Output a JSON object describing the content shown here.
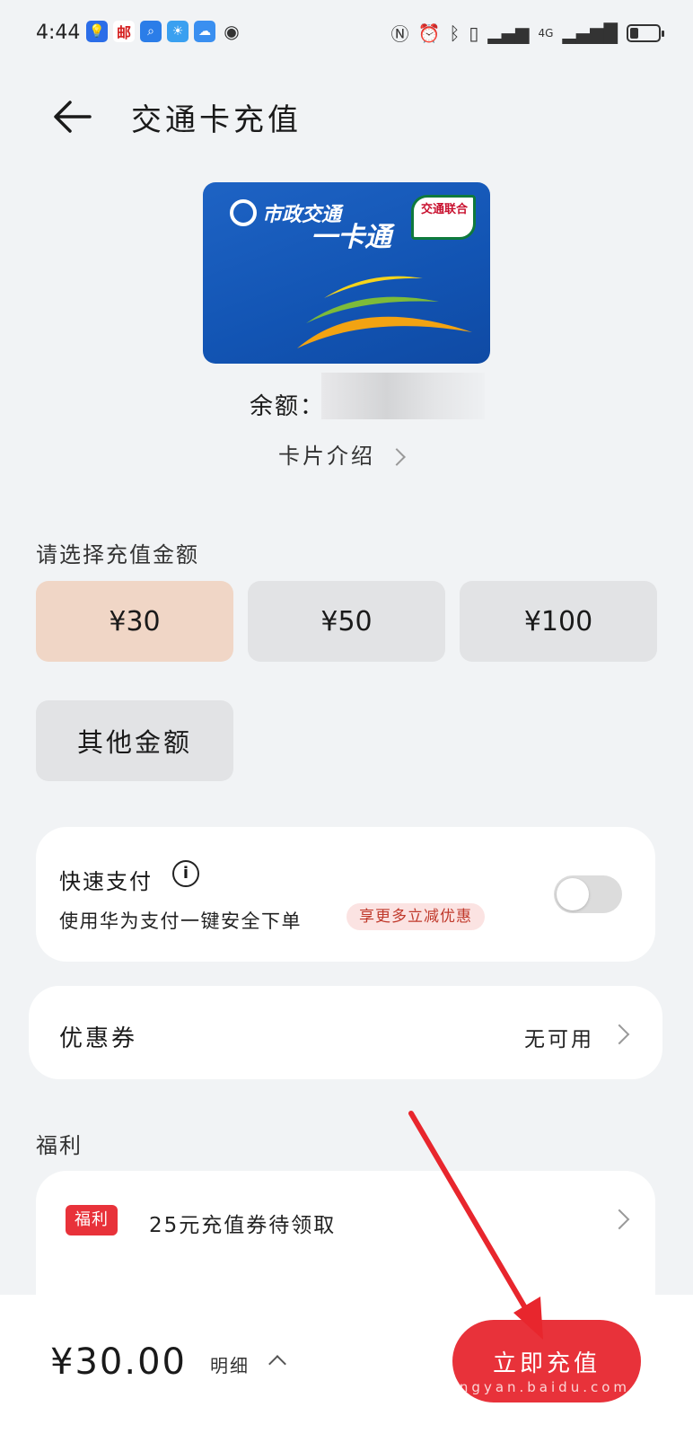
{
  "status_bar": {
    "time": "4:44",
    "network": "4G"
  },
  "header": {
    "title": "交通卡充值"
  },
  "card": {
    "brand": "市政交通",
    "name": "一卡通",
    "union_label": "交通联合"
  },
  "balance": {
    "label": "余额："
  },
  "card_intro": {
    "label": "卡片介绍"
  },
  "amount_section": {
    "label": "请选择充值金额",
    "options": [
      "¥30",
      "¥50",
      "¥100"
    ],
    "other": "其他金额",
    "selected": "¥30"
  },
  "quick_pay": {
    "title": "快速支付",
    "description": "使用华为支付一键安全下单",
    "promo": "享更多立减优惠",
    "enabled": false
  },
  "coupon": {
    "label": "优惠券",
    "value": "无可用"
  },
  "benefits": {
    "label": "福利",
    "tag": "福利",
    "text": "25元充值券待领取"
  },
  "footer": {
    "total": "¥30.00",
    "detail": "明细",
    "button": "立即充值",
    "watermark": "jingyan.baidu.com"
  },
  "colors": {
    "accent_red": "#e8323a",
    "selected_amount_bg": "#f0d6c6",
    "card_blue": "#1254b3"
  }
}
